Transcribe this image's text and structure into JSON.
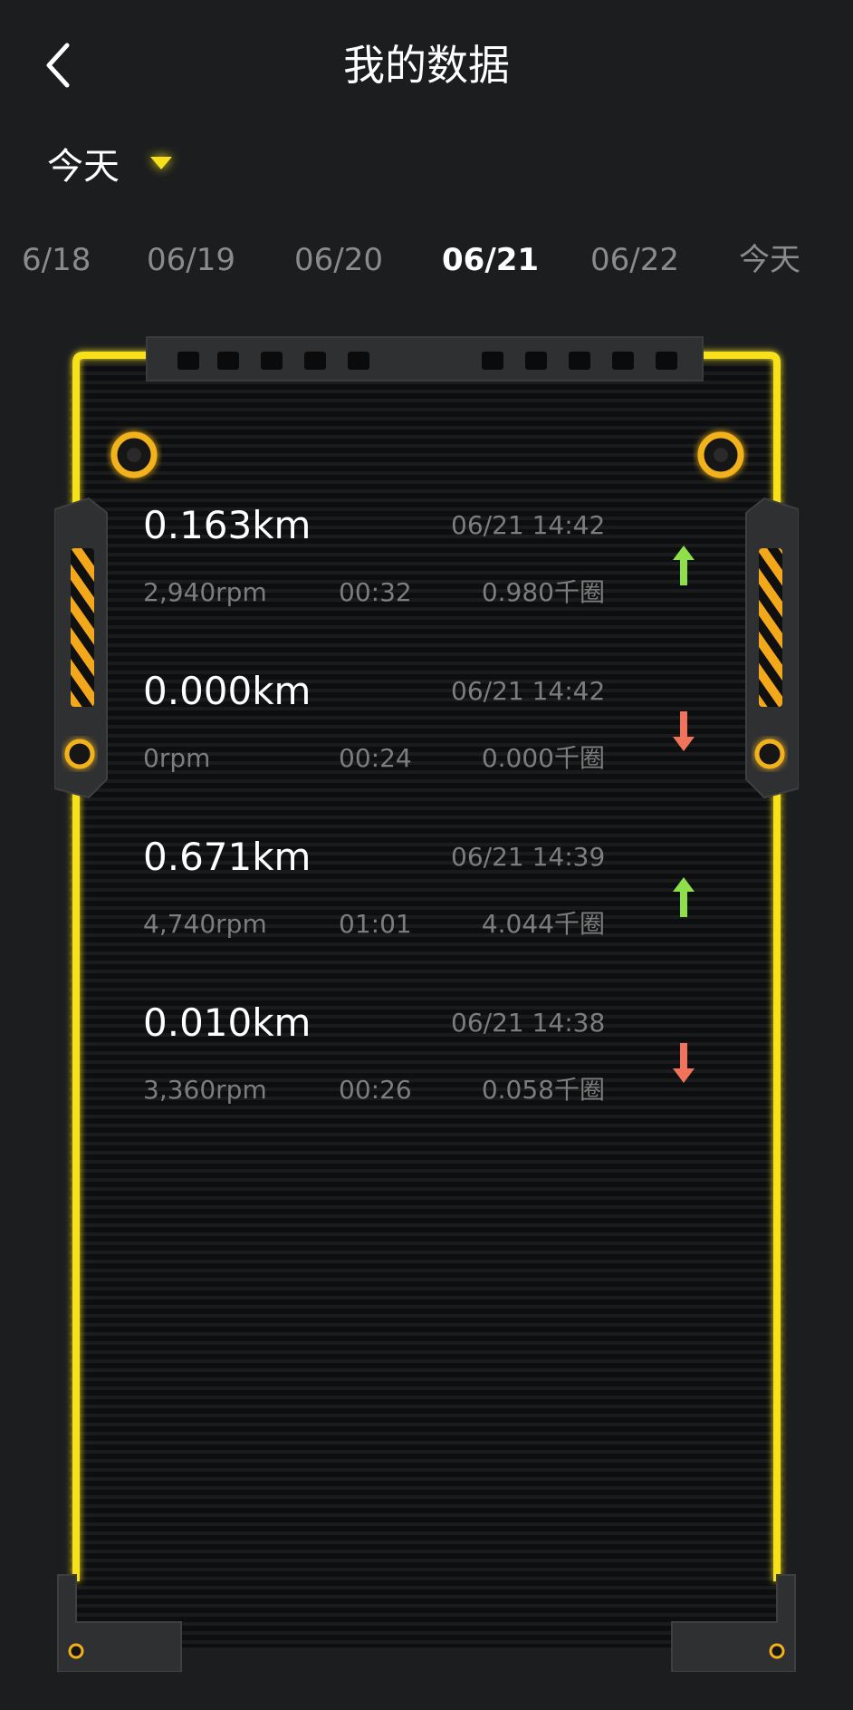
{
  "header": {
    "title": "我的数据"
  },
  "filter": {
    "label": "今天"
  },
  "dates": [
    {
      "label": "6/18",
      "active": false
    },
    {
      "label": "06/19",
      "active": false
    },
    {
      "label": "06/20",
      "active": false
    },
    {
      "label": "06/21",
      "active": true
    },
    {
      "label": "06/22",
      "active": false
    },
    {
      "label": "今天",
      "active": false
    }
  ],
  "records": [
    {
      "distance": "0.163km",
      "datetime": "06/21 14:42",
      "rpm": "2,940rpm",
      "duration": "00:32",
      "laps": "0.980千圈",
      "trend": "up"
    },
    {
      "distance": "0.000km",
      "datetime": "06/21 14:42",
      "rpm": "0rpm",
      "duration": "00:24",
      "laps": "0.000千圈",
      "trend": "down"
    },
    {
      "distance": "0.671km",
      "datetime": "06/21 14:39",
      "rpm": "4,740rpm",
      "duration": "01:01",
      "laps": "4.044千圈",
      "trend": "up"
    },
    {
      "distance": "0.010km",
      "datetime": "06/21 14:38",
      "rpm": "3,360rpm",
      "duration": "00:26",
      "laps": "0.058千圈",
      "trend": "down"
    }
  ],
  "colors": {
    "background": "#1b1d1f",
    "accent_yellow": "#f7e11a",
    "trend_up": "#8ee04a",
    "trend_down": "#f0735a",
    "muted_text": "#7d7d7d"
  }
}
